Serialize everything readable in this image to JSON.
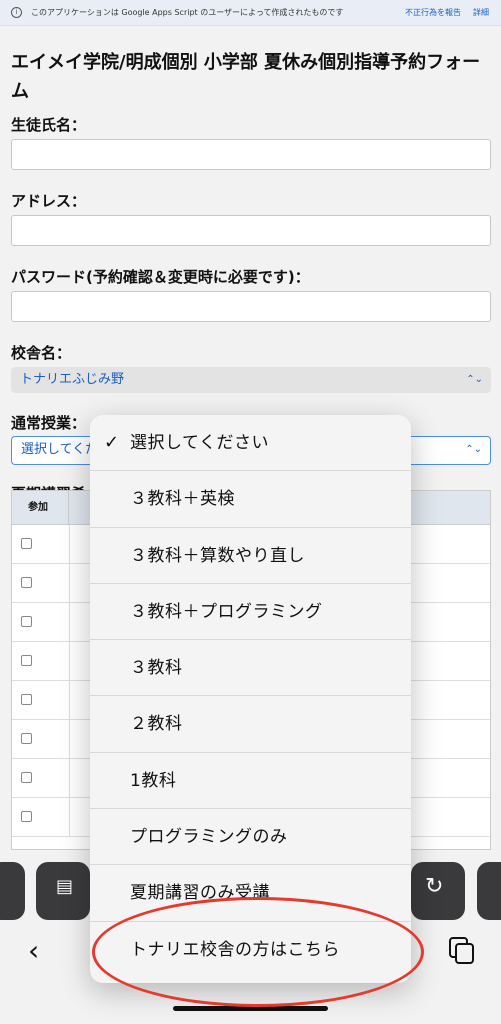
{
  "banner": {
    "notice": "このアプリケーションは Google Apps Script のユーザーによって作成されたものです",
    "report_link": "不正行為を報告",
    "details_link": "詳細"
  },
  "form": {
    "title": "エイメイ学院/明成個別 小学部 夏休み個別指導予約フォーム",
    "student_name_label": "生徒氏名：",
    "address_label": "アドレス：",
    "password_label": "パスワード(予約確認＆変更時に必要です)：",
    "school_label": "校舎名：",
    "school_value": "トナリエふじみ野",
    "regular_class_label": "通常授業：",
    "regular_class_value": "選択してくださ",
    "summer_label": "夏期講習希",
    "table_header_join": "参加"
  },
  "dropdown": {
    "selected_index": 0,
    "options": [
      "選択してください",
      "３教科＋英検",
      "３教科＋算数やり直し",
      "３教科＋プログラミング",
      "３教科",
      "２教科",
      "1教科",
      "プログラミングのみ",
      "夏期講習のみ受講",
      "トナリエ校舎の方はこちら"
    ]
  },
  "table_rows": 8,
  "highlight_color": "#e53a2f",
  "accent_color": "#1a5fc6"
}
